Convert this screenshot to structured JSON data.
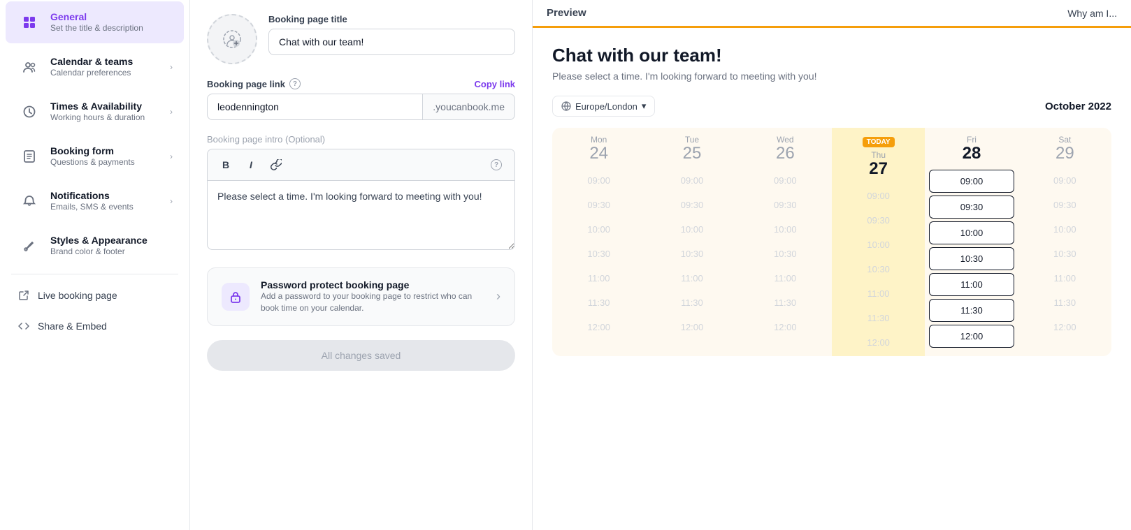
{
  "sidebar": {
    "items": [
      {
        "id": "general",
        "title": "General",
        "subtitle": "Set the title & description",
        "icon": "grid",
        "active": true,
        "hasChevron": false
      },
      {
        "id": "calendar-teams",
        "title": "Calendar & teams",
        "subtitle": "Calendar preferences",
        "icon": "users",
        "active": false,
        "hasChevron": true
      },
      {
        "id": "times-availability",
        "title": "Times & Availability",
        "subtitle": "Working hours & duration",
        "icon": "clock",
        "active": false,
        "hasChevron": true
      },
      {
        "id": "booking-form",
        "title": "Booking form",
        "subtitle": "Questions & payments",
        "icon": "form",
        "active": false,
        "hasChevron": true
      },
      {
        "id": "notifications",
        "title": "Notifications",
        "subtitle": "Emails, SMS & events",
        "icon": "bell",
        "active": false,
        "hasChevron": true
      },
      {
        "id": "styles-appearance",
        "title": "Styles & Appearance",
        "subtitle": "Brand color & footer",
        "icon": "brush",
        "active": false,
        "hasChevron": false
      }
    ],
    "links": [
      {
        "id": "live-booking",
        "label": "Live booking page",
        "icon": "external"
      },
      {
        "id": "share-embed",
        "label": "Share & Embed",
        "icon": "code"
      }
    ]
  },
  "main": {
    "photo_placeholder": "📷",
    "booking_page_title_label": "Booking page title",
    "booking_page_title_value": "Chat with our team!",
    "booking_page_link_label": "Booking page link",
    "copy_link_label": "Copy link",
    "link_slug": "leodennington",
    "link_domain": ".youcanbook.me",
    "intro_label": "Booking page intro",
    "intro_optional": "(Optional)",
    "intro_text": "Please select a time. I'm looking forward to meeting with you!",
    "password_title": "Password protect booking page",
    "password_desc": "Add a password to your booking page to restrict who can book time on your calendar.",
    "save_label": "All changes saved"
  },
  "preview": {
    "label": "Preview",
    "tab_label": "Why am I...",
    "cal_title": "Chat with our team!",
    "cal_subtitle": "Please select a time. I'm looking forward to meeting with you!",
    "timezone": "Europe/London",
    "month": "October 2022",
    "today_badge": "TODAY",
    "days": [
      {
        "name": "Mon",
        "num": "24",
        "type": "past"
      },
      {
        "name": "Tue",
        "num": "25",
        "type": "past"
      },
      {
        "name": "Wed",
        "num": "26",
        "type": "past"
      },
      {
        "name": "Thu",
        "num": "27",
        "type": "today"
      },
      {
        "name": "Fri",
        "num": "28",
        "type": "active"
      },
      {
        "name": "Sat",
        "num": "29",
        "type": "past"
      }
    ],
    "slots": [
      "09:00",
      "09:30",
      "10:00",
      "10:30",
      "11:00",
      "11:30",
      "12:00"
    ]
  }
}
